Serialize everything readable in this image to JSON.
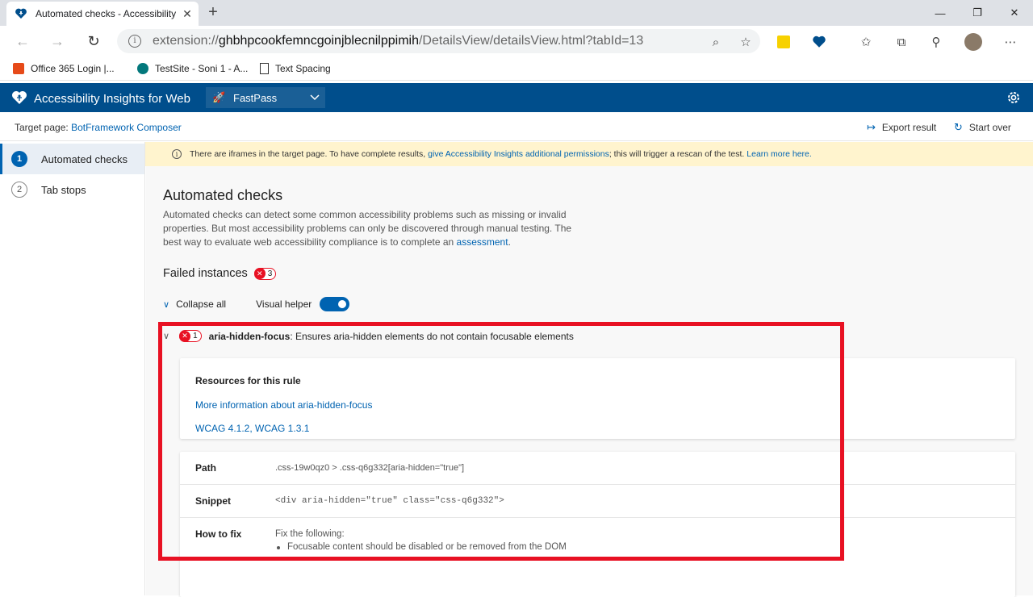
{
  "browser": {
    "tab_title": "Automated checks - Accessibility",
    "url_scheme": "extension://",
    "url_host": "ghbhpcookfemncgoinjblecnilppimih",
    "url_path": "/DetailsView/detailsView.html?tabId=13",
    "bookmarks": [
      "Office 365 Login |...",
      "TestSite - Soni 1 - A...",
      "Text Spacing"
    ]
  },
  "app": {
    "title": "Accessibility Insights for Web",
    "mode": "FastPass",
    "target_label": "Target page:",
    "target_page": "BotFramework Composer",
    "export": "Export result",
    "start_over": "Start over"
  },
  "nav": [
    {
      "num": "1",
      "label": "Automated checks"
    },
    {
      "num": "2",
      "label": "Tab stops"
    }
  ],
  "notice": {
    "text1": "There are iframes in the target page. To have complete results,",
    "link1": "give Accessibility Insights additional permissions",
    "text2": "; this will trigger a rescan of the test.",
    "link2": "Learn more here."
  },
  "main": {
    "heading": "Automated checks",
    "desc_text": "Automated checks can detect some common accessibility problems such as missing or invalid properties. But most accessibility problems can only be discovered through manual testing. The best way to evaluate web accessibility compliance is to complete an",
    "desc_link": "assessment",
    "desc_end": ".",
    "failed_label": "Failed instances",
    "failed_count": "3",
    "collapse_all": "Collapse all",
    "visual_helper": "Visual helper"
  },
  "rule": {
    "count": "1",
    "id": "aria-hidden-focus",
    "description": ": Ensures aria-hidden elements do not contain focusable elements",
    "resources_title": "Resources for this rule",
    "more_info": "More information about aria-hidden-focus",
    "wcag": "WCAG 4.1.2, WCAG 1.3.1",
    "path_label": "Path",
    "path_value": ".css-19w0qz0 > .css-q6g332[aria-hidden=\"true\"]",
    "snippet_label": "Snippet",
    "snippet_value": "<div aria-hidden=\"true\" class=\"css-q6g332\">",
    "fix_label": "How to fix",
    "fix_intro": "Fix the following:",
    "fix_item": "Focusable content should be disabled or be removed from the DOM"
  },
  "colors": {
    "brand": "#004e8c",
    "link": "#0063b1",
    "error": "#e81123",
    "notice_bg": "#fff4ce"
  }
}
